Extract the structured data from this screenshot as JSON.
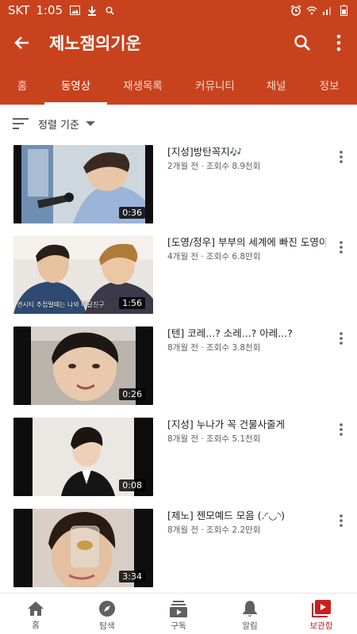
{
  "status": {
    "carrier": "SKT",
    "time": "1:05"
  },
  "header": {
    "title": "제노잼의기운",
    "back_icon": "arrow-left-icon",
    "search_icon": "search-icon",
    "more_icon": "more-vertical-icon"
  },
  "tabs": [
    "홈",
    "동영상",
    "재생목록",
    "커뮤니티",
    "채널",
    "정보"
  ],
  "active_tab": "동영상",
  "sort": {
    "label": "정렬 기준"
  },
  "videos": [
    {
      "title": "[지성]방탄꼭지🎶",
      "meta": "2개월 전 · 조회수 8.9천회",
      "duration": "0:36"
    },
    {
      "title": "[도영/정우] 부부의 세계에 빠진 도영이",
      "meta": "4개월 전 · 조회수 6.8만회",
      "duration": "1:56",
      "caption": "엔시티 추접떨때는 나와 며글친구"
    },
    {
      "title": "[텐] 코레...? 소레...? 아레...?",
      "meta": "8개월 전 · 조회수 3.8천회",
      "duration": "0:26"
    },
    {
      "title": "[지성] 누나가 꼭 건물사줄게",
      "meta": "8개월 전 · 조회수 5.1천회",
      "duration": "0:08"
    },
    {
      "title": "[제노] 젠모예드 모음 (.◜◡◝)",
      "meta": "8개월 전 · 조회수 2.2만회",
      "duration": "3:34"
    }
  ],
  "bottom_nav": [
    "홈",
    "탐색",
    "구독",
    "알림",
    "보관함"
  ],
  "active_nav": "보관함",
  "colors": {
    "brand": "#c8421d",
    "active_nav": "#cc1e1e"
  }
}
